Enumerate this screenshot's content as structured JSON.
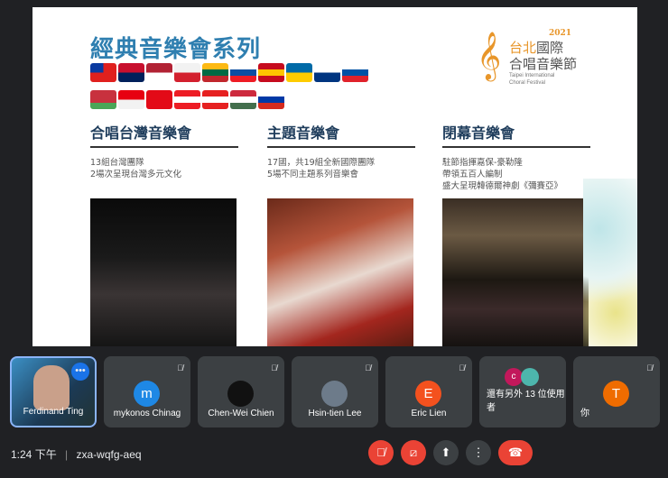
{
  "slide": {
    "title": "經典音樂會系列",
    "flags": [
      {
        "name": "taiwan",
        "colors": [
          "#e0201e",
          "#e0201e"
        ]
      },
      {
        "name": "norway",
        "colors": [
          "#c8102e",
          "#00205b"
        ]
      },
      {
        "name": "usa",
        "colors": [
          "#b22234",
          "#fff"
        ]
      },
      {
        "name": "japan",
        "colors": [
          "#f2f2f2",
          "#d3202e"
        ]
      },
      {
        "name": "lithuania",
        "colors": [
          "#fdb913",
          "#006a44",
          "#c1272d"
        ]
      },
      {
        "name": "slovakia",
        "colors": [
          "#fff",
          "#0b4ea2",
          "#ee1c25"
        ]
      },
      {
        "name": "spain",
        "colors": [
          "#c60b1e",
          "#ffc400",
          "#c60b1e"
        ]
      },
      {
        "name": "sweden",
        "colors": [
          "#006aa7",
          "#fecc00"
        ]
      },
      {
        "name": "finland",
        "colors": [
          "#fff",
          "#003580"
        ]
      },
      {
        "name": "slovenia",
        "colors": [
          "#fff",
          "#0052a5",
          "#e0222b"
        ]
      },
      {
        "name": "belarus",
        "colors": [
          "#c8313e",
          "#c8313e",
          "#4aa657"
        ]
      },
      {
        "name": "indonesia",
        "colors": [
          "#e70011",
          "#f2f2f2"
        ]
      },
      {
        "name": "turkey",
        "colors": [
          "#e30a17",
          "#e30a17"
        ]
      },
      {
        "name": "lebanon",
        "colors": [
          "#ed1c24",
          "#fff",
          "#ed1c24"
        ]
      },
      {
        "name": "canada",
        "colors": [
          "#e62020",
          "#fff",
          "#e62020"
        ]
      },
      {
        "name": "hungary",
        "colors": [
          "#cd2a3e",
          "#fff",
          "#436f4d"
        ]
      },
      {
        "name": "russia",
        "colors": [
          "#fff",
          "#0039a6",
          "#d52b1e"
        ]
      }
    ],
    "logo": {
      "year": "2021",
      "line1a": "台北",
      "line1b": "國際",
      "line2": "合唱音樂節",
      "line3": "Taipei International",
      "line4": "Choral Festival"
    },
    "columns": [
      {
        "heading": "合唱台灣音樂會",
        "lines": [
          "13組台灣團隊",
          "2場次呈現台灣多元文化"
        ]
      },
      {
        "heading": "主題音樂會",
        "lines": [
          "17國，共19組全新國際團隊",
          "5場不同主題系列音樂會"
        ]
      },
      {
        "heading": "閉幕音樂會",
        "lines": [
          "駐節指揮嘉保-豪勒隆",
          "帶領五百人編制",
          "盛大呈現韓德爾神劇《彌賽亞》"
        ]
      }
    ]
  },
  "participants": [
    {
      "name": "Ferdinand Ting",
      "type": "video"
    },
    {
      "name": "mykonos Chinag",
      "initial": "m",
      "color": "#1e88e5",
      "muted": true
    },
    {
      "name": "Chen-Wei Chien",
      "initial": "",
      "color": "#111",
      "muted": true
    },
    {
      "name": "Hsin-tien Lee",
      "initial": "",
      "color": "#6d7b8a",
      "muted": true
    },
    {
      "name": "Eric Lien",
      "initial": "E",
      "color": "#f4511e",
      "muted": true
    },
    {
      "name": "還有另外 13 位使用者",
      "initial": "c",
      "color": "#c2185b"
    },
    {
      "name": "你",
      "initial": "T",
      "color": "#ef6c00",
      "muted": true
    }
  ],
  "footer": {
    "time": "1:24 下午",
    "separator": "|",
    "meeting_code": "zxa-wqfg-aeq"
  },
  "controls": {
    "mic": "mic-off",
    "camera": "camera-off",
    "present": "present",
    "more": "⋮",
    "hangup": "hang-up"
  },
  "colors": {
    "danger": "#ea4335",
    "bg": "#202124",
    "tile": "#3c4043"
  }
}
